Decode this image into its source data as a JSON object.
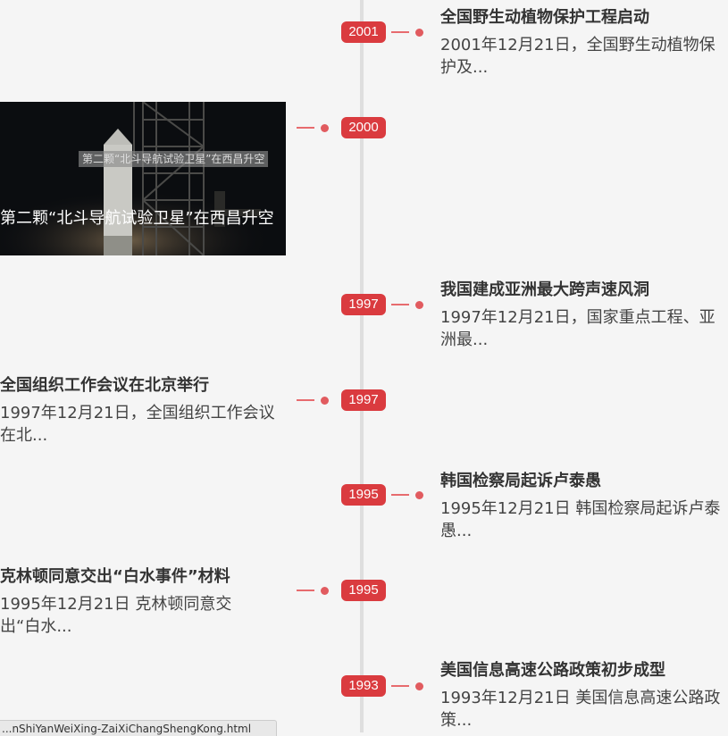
{
  "timeline": {
    "entries": [
      {
        "year": "2001",
        "side": "right",
        "title": "全国野生动植物保护工程启动",
        "excerpt": "2001年12月21日，全国野生动植物保护及..."
      },
      {
        "year": "2000",
        "side": "left",
        "photo_overlay_text": "第二颗“北斗导航试验卫星”在西昌升空",
        "caption": "第二颗“北斗导航试验卫星”在西昌升空"
      },
      {
        "year": "1997",
        "side": "right",
        "title": "我国建成亚洲最大跨声速风洞",
        "excerpt": "1997年12月21日，国家重点工程、亚洲最..."
      },
      {
        "year": "1997",
        "side": "left",
        "title": "全国组织工作会议在北京举行",
        "excerpt": "1997年12月21日，全国组织工作会议在北..."
      },
      {
        "year": "1995",
        "side": "right",
        "title": "韩国检察局起诉卢泰愚",
        "excerpt": "1995年12月21日 韩国检察局起诉卢泰愚..."
      },
      {
        "year": "1995",
        "side": "left",
        "title": "克林顿同意交出“白水事件”材料",
        "excerpt": "1995年12月21日 克林顿同意交出“白水..."
      },
      {
        "year": "1993",
        "side": "right",
        "title": "美国信息高速公路政策初步成型",
        "excerpt": "1993年12月21日 美国信息高速公路政策..."
      }
    ]
  },
  "status_bar": {
    "url": "...nShiYanWeiXing-ZaiXiChangShengKong.html"
  },
  "colors": {
    "accent": "#da3b3f",
    "connector": "#e76b6e",
    "axis": "#dedede",
    "background": "#f5f5f5"
  }
}
